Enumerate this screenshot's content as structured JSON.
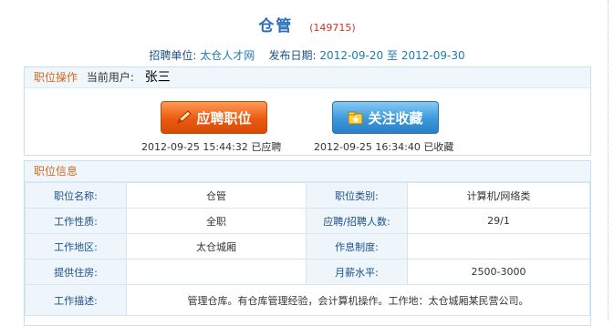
{
  "header": {
    "title": "仓管",
    "job_id": "(149715)",
    "employer_label": "招聘单位:",
    "employer": "太仓人才网",
    "date_label": "发布日期:",
    "date_start": "2012-09-20",
    "date_sep": "至",
    "date_end": "2012-09-30"
  },
  "operations": {
    "title": "职位操作",
    "user_label": "当前用户:",
    "user": "张三",
    "apply_button": "应聘职位",
    "favorite_button": "关注收藏",
    "apply_status": "2012-09-25 15:44:32 已应聘",
    "favorite_status": "2012-09-25 16:34:40 已收藏"
  },
  "info": {
    "title": "职位信息",
    "rows": [
      {
        "l1": "职位名称:",
        "v1": "仓管",
        "l2": "职位类别:",
        "v2": "计算机/网络类"
      },
      {
        "l1": "工作性质:",
        "v1": "全职",
        "l2": "应聘/招聘人数:",
        "v2": "29/1"
      },
      {
        "l1": "工作地区:",
        "v1": "太仓城厢",
        "l2": "作息制度:",
        "v2": ""
      },
      {
        "l1": "提供住房:",
        "v1": "",
        "l2": "月薪水平:",
        "v2": "2500-3000"
      }
    ],
    "desc_label": "工作描述:",
    "desc": "管理仓库。有仓库管理经验，会计算机操作。工作地：太仓城厢某民营公司。"
  },
  "colors": {
    "title_blue": "#2a6fb8",
    "accent_orange": "#d2691e",
    "apply_orange": "#ec5a10",
    "favorite_blue": "#3a99dd"
  },
  "icons": {
    "apply": "pen-icon",
    "favorite": "folder-star-icon"
  }
}
